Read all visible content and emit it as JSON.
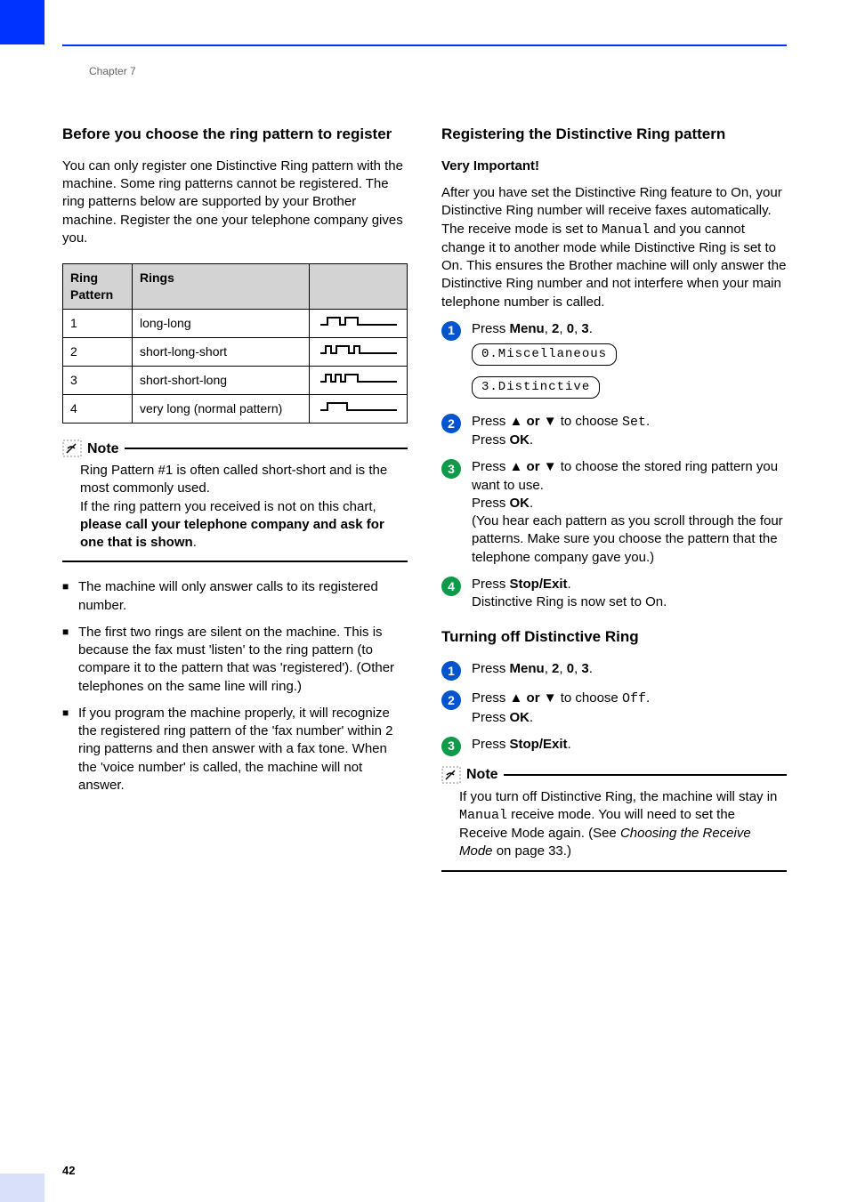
{
  "chapter": "Chapter 7",
  "page_number": "42",
  "left": {
    "heading": "Before you choose the ring pattern to register",
    "intro": "You can only register one Distinctive Ring pattern with the machine. Some ring patterns cannot be registered. The ring patterns below are supported by your Brother machine. Register the one your telephone company gives you.",
    "table": {
      "headers": [
        "Ring Pattern",
        "Rings"
      ],
      "rows": [
        {
          "num": "1",
          "desc": "long-long"
        },
        {
          "num": "2",
          "desc": "short-long-short"
        },
        {
          "num": "3",
          "desc": "short-short-long"
        },
        {
          "num": "4",
          "desc": "very long (normal pattern)"
        }
      ]
    },
    "note_label": "Note",
    "note_text_pre": "Ring Pattern #1 is often called short-short and is the most commonly used.",
    "note_text_if": "If the ring pattern you received is not on this chart, ",
    "note_text_bold": "please call your telephone company and ask for one that is shown",
    "note_text_period": ".",
    "bullets": [
      "The machine will only answer calls to its registered number.",
      "The first two rings are silent on the machine. This is because the fax must 'listen' to the ring pattern (to compare it to the pattern that was 'registered'). (Other telephones on the same line will ring.)",
      "If you program the machine properly, it will recognize the registered ring pattern of the 'fax number' within 2 ring patterns and then answer with a fax tone. When the 'voice number' is called, the machine will not answer."
    ]
  },
  "right": {
    "heading1": "Registering the Distinctive Ring pattern",
    "very_important_label": "Very Important!",
    "intro1_a": "After you have set the Distinctive Ring feature to On, your Distinctive Ring number will receive faxes automatically. The receive mode is set to ",
    "intro1_mono": "Manual",
    "intro1_b": " and you cannot change it to another mode while Distinctive Ring is set to On. This ensures the Brother machine will only answer the Distinctive Ring number and not interfere when your main telephone number is called.",
    "steps1": [
      {
        "color": "#0055cc",
        "num": "1",
        "text_pre": "Press ",
        "text_bold": "Menu",
        "text_post": ", ",
        "seq": [
          "2",
          "0",
          "3"
        ],
        "lcds": [
          "0.Miscellaneous",
          "3.Distinctive"
        ]
      },
      {
        "color": "#0055cc",
        "num": "2",
        "text_a": "Press ",
        "arrows": "▲ or ▼",
        "text_b": " to choose ",
        "mono": "Set",
        "text_c": ".",
        "press_label": "Press ",
        "ok_label": "OK",
        "period": "."
      },
      {
        "color": "#0d9b4a",
        "num": "3",
        "text_a": "Press ",
        "arrows": "▲ or ▼",
        "text_b": " to choose the stored ring pattern you want to use.",
        "press_label": "Press ",
        "ok_label": "OK",
        "period": ".",
        "extra": "(You hear each pattern as you scroll through the four patterns. Make sure you choose the pattern that the telephone company gave you.)"
      },
      {
        "color": "#0d9b4a",
        "num": "4",
        "text_a": "Press ",
        "bold": "Stop/Exit",
        "text_c": ".",
        "extra": "Distinctive Ring is now set to On."
      }
    ],
    "heading2": "Turning off Distinctive Ring",
    "steps2": [
      {
        "color": "#0055cc",
        "num": "1",
        "text_pre": "Press ",
        "text_bold": "Menu",
        "text_post": ", ",
        "seq": [
          "2",
          "0",
          "3"
        ]
      },
      {
        "color": "#0055cc",
        "num": "2",
        "text_a": "Press ",
        "arrows": "▲ or ▼",
        "text_b": " to choose ",
        "mono": "Off",
        "text_c": ".",
        "press_label": "Press ",
        "ok_label": "OK",
        "period": "."
      },
      {
        "color": "#0d9b4a",
        "num": "3",
        "text_a": "Press ",
        "bold": "Stop/Exit",
        "text_c": "."
      }
    ],
    "note_label": "Note",
    "note2_a": "If you turn off Distinctive Ring, the machine will stay in ",
    "note2_mono": "Manual",
    "note2_b": " receive mode. You will need to set the Receive Mode again. (See ",
    "note2_italic": "Choosing the Receive Mode",
    "note2_c": " on page 33.)"
  }
}
